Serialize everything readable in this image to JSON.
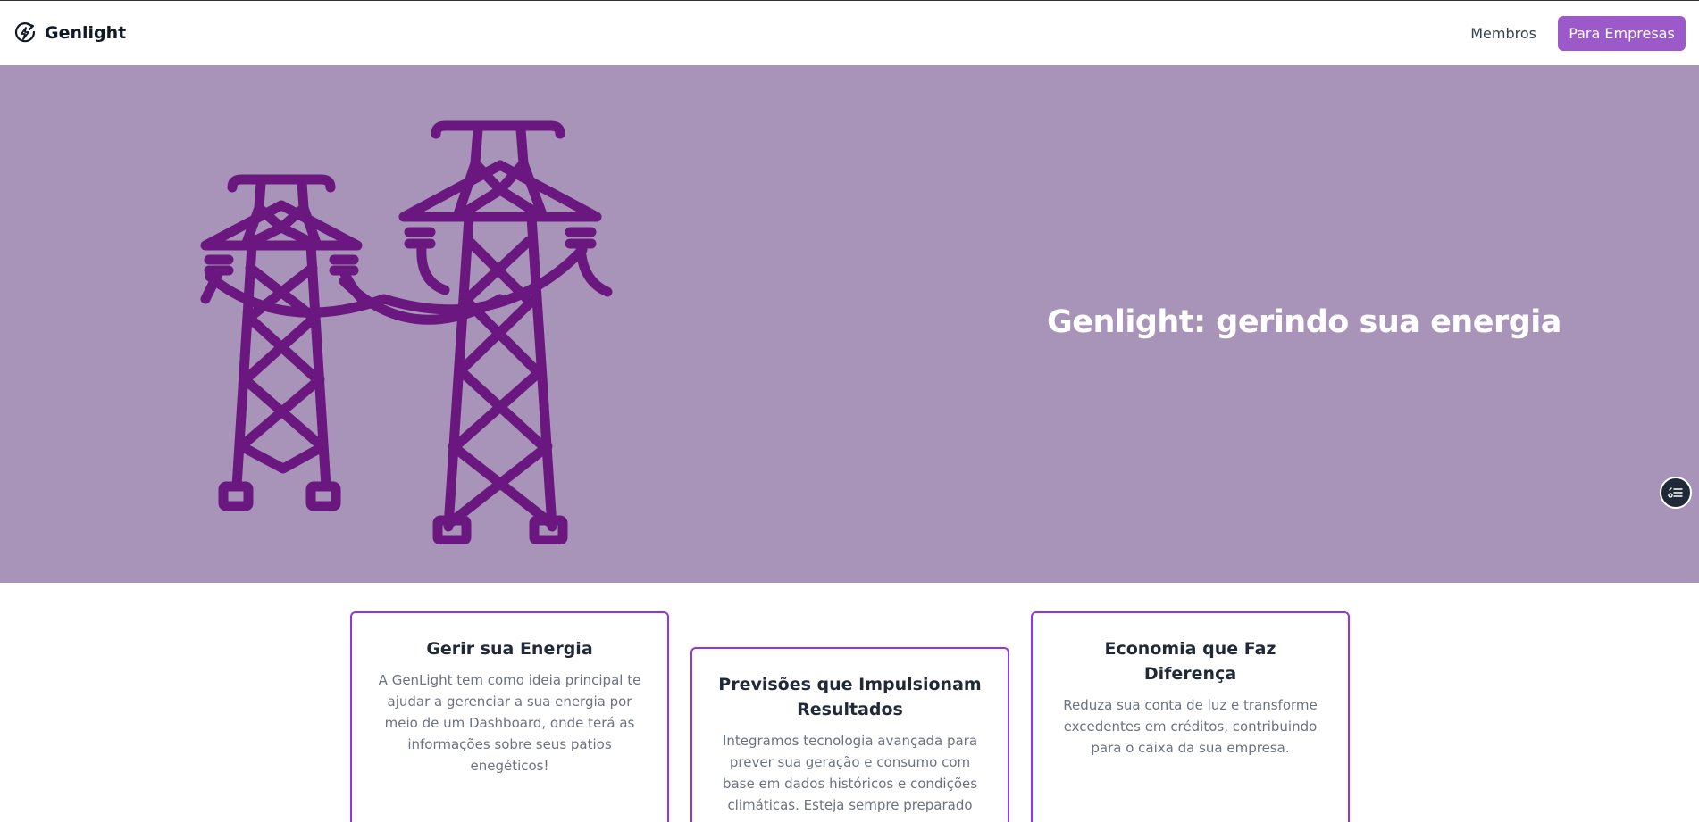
{
  "header": {
    "brand": "Genlight",
    "nav": {
      "members_label": "Membros"
    },
    "cta_label": "Para Empresas"
  },
  "hero": {
    "title": "Genlight: gerindo sua energia",
    "illustration": "transmission-towers-icon",
    "background_color": "#a894b8",
    "illustration_color": "#6b1780"
  },
  "features": [
    {
      "title": "Gerir sua Energia",
      "text": "A GenLight tem como ideia principal te ajudar a gerenciar a sua energia por meio de um Dashboard, onde terá as informações sobre seus patios enegéticos!"
    },
    {
      "title": "Previsões que Impulsionam Resultados",
      "text": "Integramos tecnologia avançada para prever sua geração e consumo com base em dados históricos e condições climáticas. Esteja sempre preparado"
    },
    {
      "title": "Economia que Faz Diferença",
      "text": "Reduza sua conta de luz e transforme excedentes em créditos, contribuindo para o caixa da sua empresa."
    }
  ],
  "colors": {
    "accent": "#9b59c9",
    "card_border": "#9333ea"
  }
}
